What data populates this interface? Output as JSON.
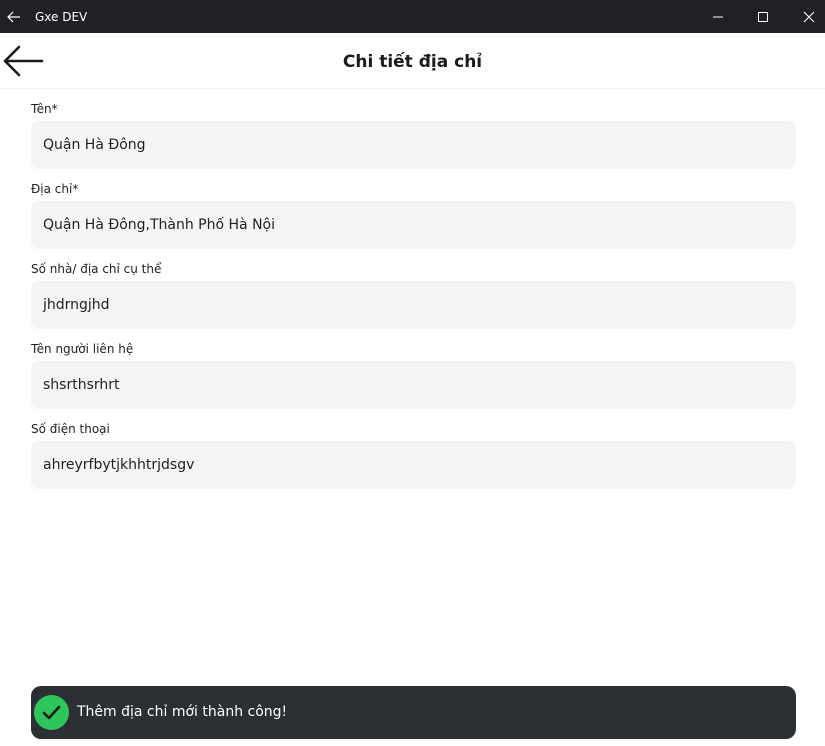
{
  "window": {
    "title": "Gxe DEV"
  },
  "appbar": {
    "title": "Chi tiết địa chỉ"
  },
  "form": {
    "fields": [
      {
        "label": "Tên*",
        "value": "Quận Hà Đông"
      },
      {
        "label": "Địa chỉ*",
        "value": "Quận Hà Đông,Thành Phố Hà Nội"
      },
      {
        "label": "Số nhà/ địa chỉ cụ thể",
        "value": "jhdrngjhd"
      },
      {
        "label": "Tên người liên hệ",
        "value": "shsrthsrhrt"
      },
      {
        "label": "Số điện thoại",
        "value": "ahreyrfbytjkhhtrjdsgv"
      }
    ]
  },
  "toast": {
    "message": "Thêm địa chỉ mới thành công!",
    "icon": "check-circle-icon",
    "accent_color": "#2ec55a"
  },
  "colors": {
    "titlebar_bg": "#202124",
    "field_bg": "#f4f4f4",
    "toast_bg": "#2c2f34"
  }
}
